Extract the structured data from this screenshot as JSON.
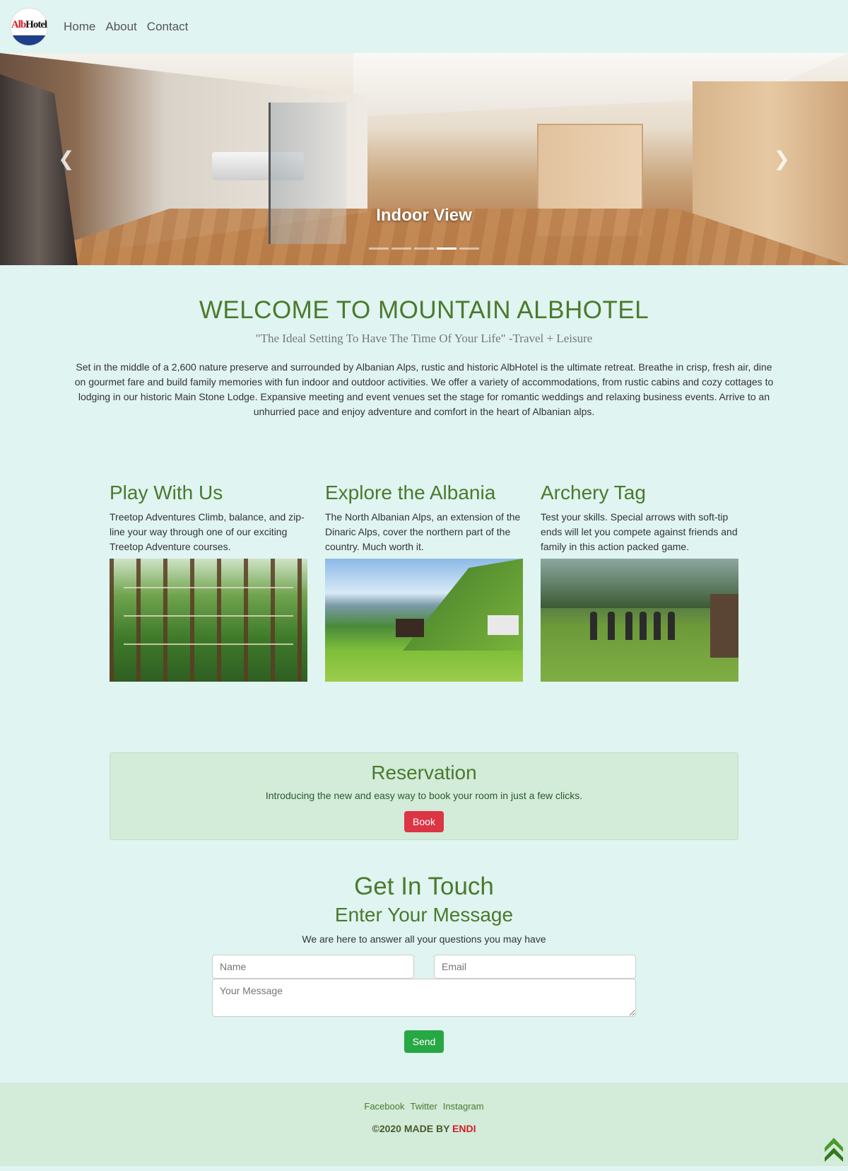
{
  "navbar": {
    "logo_text_a": "Alb",
    "logo_text_b": "Hotel",
    "links": [
      "Home",
      "About",
      "Contact"
    ]
  },
  "carousel": {
    "caption": "Indoor View",
    "slide_count": 5,
    "active_index": 3
  },
  "welcome": {
    "title": "WELCOME TO MOUNTAIN ALBHOTEL",
    "quote": "\"The Ideal Setting To Have The Time Of Your Life\" -Travel + Leisure",
    "text": "Set in the middle of a 2,600 nature preserve and surrounded by Albanian Alps, rustic and historic AlbHotel is the ultimate retreat. Breathe in crisp, fresh air, dine on gourmet fare and build family memories with fun indoor and outdoor activities. We offer a variety of accommodations, from rustic cabins and cozy cottages to lodging in our historic Main Stone Lodge. Expansive meeting and event venues set the stage for romantic weddings and relaxing business events. Arrive to an unhurried pace and enjoy adventure and comfort in the heart of Albanian alps."
  },
  "features": [
    {
      "title": "Play With Us",
      "text": "Treetop Adventures Climb, balance, and zip-line your way through one of our exciting Treetop Adventure courses."
    },
    {
      "title": "Explore the Albania",
      "text": "The North Albanian Alps, an extension of the Dinaric Alps, cover the northern part of the country. Much worth it."
    },
    {
      "title": "Archery Tag",
      "text": "Test your skills. Special arrows with soft-tip ends will let you compete against friends and family in this action packed game."
    }
  ],
  "reservation": {
    "title": "Reservation",
    "text": "Introducing the new and easy way to book your room in just a few clicks.",
    "button": "Book"
  },
  "contact": {
    "title": "Get In Touch",
    "subtitle": "Enter Your Message",
    "text": "We are here to answer all your questions you may have",
    "name_placeholder": "Name",
    "email_placeholder": "Email",
    "message_placeholder": "Your Message",
    "button": "Send"
  },
  "footer": {
    "links": [
      "Facebook",
      "Twitter",
      "Instagram"
    ],
    "copy_prefix": "©2020 MADE BY ",
    "author": "ENDI"
  },
  "colors": {
    "page_bg": "#e0f4f1",
    "heading_green": "#4a7a2d",
    "book_red": "#dc3545",
    "send_green": "#28a745",
    "panel_bg": "#d3ebd9"
  },
  "icons": {
    "carousel_prev": "chevron-left-icon",
    "carousel_next": "chevron-right-icon",
    "back_to_top": "double-chevron-up-icon"
  }
}
